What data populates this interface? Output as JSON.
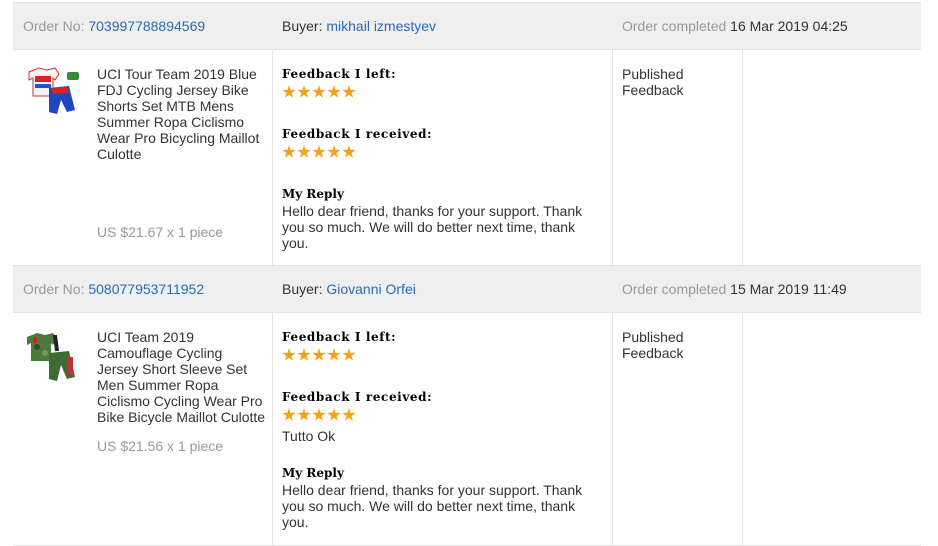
{
  "orders": [
    {
      "order_no_label": "Order No:",
      "order_no": "703997788894569",
      "buyer_label": "Buyer:",
      "buyer": "mikhail izmestyev",
      "completed_label": "Order completed",
      "completed_date": "16 Mar 2019 04:25",
      "product_title": "UCI Tour Team 2019 Blue FDJ Cycling Jersey Bike Shorts Set MTB Mens Summer Ropa Ciclismo Wear Pro Bicycling Maillot Culotte",
      "price": "US $21.67 x 1 piece",
      "feedback_left_label": "Feedback I left:",
      "feedback_left_rating": 5,
      "feedback_received_label": "Feedback I received:",
      "feedback_received_rating": 5,
      "received_comment": "",
      "reply_label": "My Reply",
      "reply_text": "Hello dear friend, thanks for your support. Thank you so much. We will do better next time, thank you.",
      "status": "Published Feedback"
    },
    {
      "order_no_label": "Order No:",
      "order_no": "508077953711952",
      "buyer_label": "Buyer:",
      "buyer": "Giovanni Orfei",
      "completed_label": "Order completed",
      "completed_date": "15 Mar 2019 11:49",
      "product_title": "UCI Team 2019 Camouflage Cycling Jersey Short Sleeve Set Men Summer Ropa Ciclismo Cycling Wear Pro Bike Bicycle Maillot Culotte",
      "price": "US $21.56 x 1 piece",
      "feedback_left_label": "Feedback I left:",
      "feedback_left_rating": 5,
      "feedback_received_label": "Feedback I received:",
      "feedback_received_rating": 5,
      "received_comment": "Tutto Ok",
      "reply_label": "My Reply",
      "reply_text": "Hello dear friend, thanks for your support. Thank you so much. We will do better next time, thank you.",
      "status": "Published Feedback"
    }
  ],
  "colors": {
    "link": "#2a6ab6",
    "star": "#f5a11a",
    "header_bg": "#efefef"
  }
}
